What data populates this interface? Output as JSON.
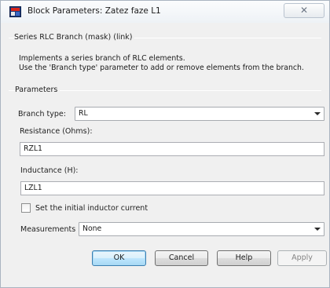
{
  "window": {
    "title": "Block Parameters: Zatez faze L1",
    "close_glyph": "✕"
  },
  "mask": {
    "group_title": "Series RLC Branch (mask) (link)",
    "description_line1": "Implements a series branch of RLC elements.",
    "description_line2": "Use the 'Branch type' parameter to add or remove elements from the branch."
  },
  "parameters": {
    "group_title": "Parameters",
    "branch_type_label": "Branch type:",
    "branch_type_value": "RL",
    "resistance_label": "Resistance (Ohms):",
    "resistance_value": "RZL1",
    "inductance_label": "Inductance (H):",
    "inductance_value": "LZL1",
    "initial_current_label": "Set the initial inductor current",
    "initial_current_checked": false,
    "measurements_label": "Measurements",
    "measurements_value": "None"
  },
  "buttons": {
    "ok": "OK",
    "cancel": "Cancel",
    "help": "Help",
    "apply": "Apply"
  },
  "icons": {
    "app": "simulink-block-icon",
    "close": "close-icon",
    "dropdown": "chevron-down-icon"
  },
  "colors": {
    "dialog_bg": "#f0f0f0",
    "default_button_border": "#3c7fb1"
  }
}
